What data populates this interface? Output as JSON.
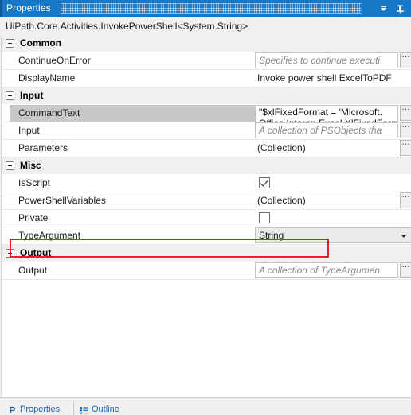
{
  "window": {
    "title": "Properties",
    "chevron_icon": "chevron-down-icon",
    "pin_icon": "pin-icon",
    "accent_color": "#1878c8"
  },
  "type_line": "UiPath.Core.Activities.InvokePowerShell<System.String>",
  "annotation": {
    "color": "#e8231b",
    "target": "PowerShellVariables"
  },
  "groups": [
    {
      "label": "Common",
      "expanded": true,
      "rows": [
        {
          "name": "ContinueOnError",
          "kind": "hintbox",
          "value": "",
          "placeholder": "Specifies to continue executi",
          "ellipsis": true,
          "selected": false
        },
        {
          "name": "DisplayName",
          "kind": "text",
          "value": "Invoke power shell ExcelToPDF",
          "ellipsis": false,
          "selected": false
        }
      ]
    },
    {
      "label": "Input",
      "expanded": true,
      "rows": [
        {
          "name": "CommandText",
          "kind": "code",
          "value": "\"$xlFixedFormat = 'Microsoft.",
          "value_line2": "Office.Interop.Excel.XlFixedFormatType'",
          "ellipsis": true,
          "selected": true
        },
        {
          "name": "Input",
          "kind": "hintbox",
          "value": "",
          "placeholder": "A collection of PSObjects tha",
          "ellipsis": true,
          "selected": false
        },
        {
          "name": "Parameters",
          "kind": "text",
          "value": "(Collection)",
          "ellipsis": true,
          "selected": false
        }
      ]
    },
    {
      "label": "Misc",
      "expanded": true,
      "rows": [
        {
          "name": "IsScript",
          "kind": "checkbox",
          "checked": true,
          "ellipsis": false,
          "selected": false
        },
        {
          "name": "PowerShellVariables",
          "kind": "text",
          "value": "(Collection)",
          "ellipsis": true,
          "selected": false,
          "annotated": true
        },
        {
          "name": "Private",
          "kind": "checkbox",
          "checked": false,
          "ellipsis": false,
          "selected": false
        },
        {
          "name": "TypeArgument",
          "kind": "dropdown",
          "value": "String",
          "ellipsis": false,
          "selected": false
        }
      ]
    },
    {
      "label": "Output",
      "expanded": true,
      "rows": [
        {
          "name": "Output",
          "kind": "hintbox",
          "value": "",
          "placeholder": "A collection of TypeArgumen",
          "ellipsis": true,
          "selected": false
        }
      ]
    }
  ],
  "bottom_tabs": [
    {
      "label": "Properties",
      "icon": "properties-icon",
      "active": true
    },
    {
      "label": "Outline",
      "icon": "outline-icon",
      "active": false
    }
  ]
}
